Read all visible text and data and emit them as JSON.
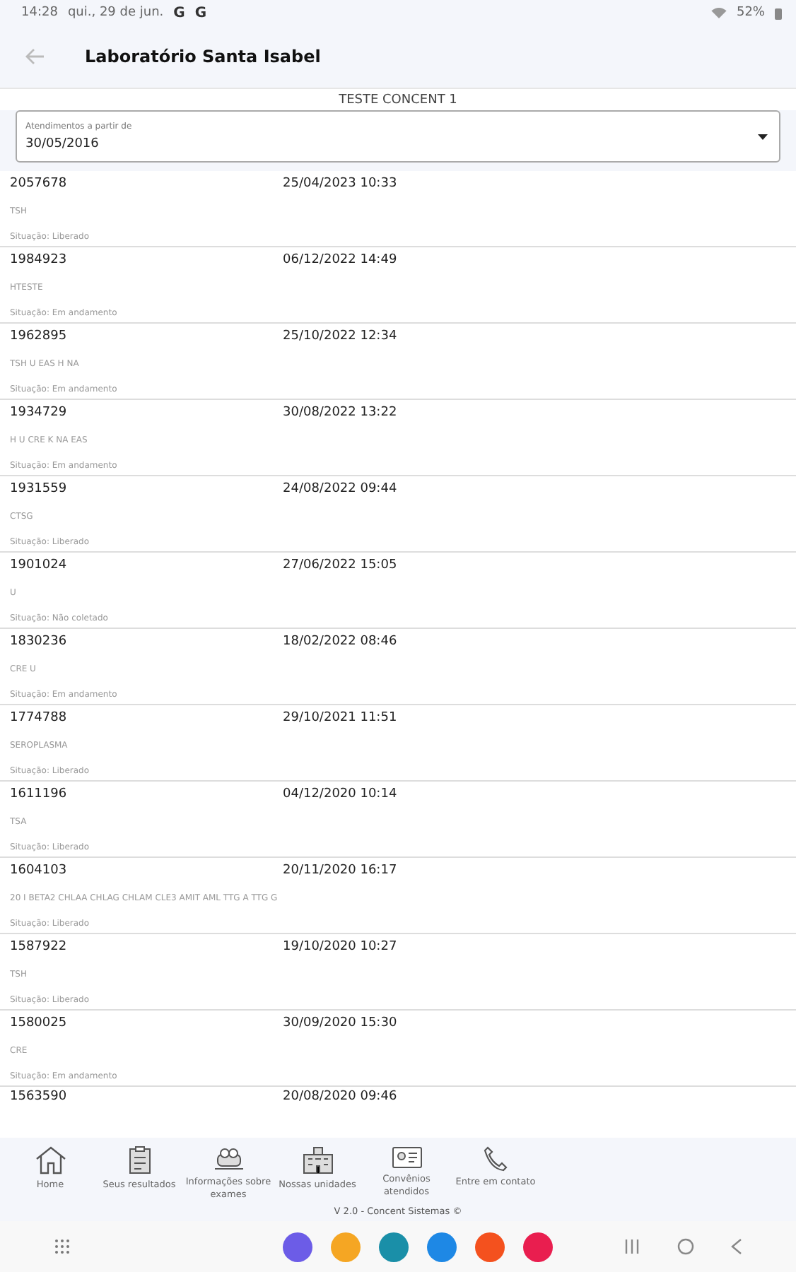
{
  "status_bar": {
    "time": "14:28",
    "date": "qui., 29 de jun.",
    "notification_icons": [
      "G",
      "G"
    ],
    "battery": "52%"
  },
  "app_bar": {
    "title": "Laboratório Santa Isabel"
  },
  "patient": "TESTE CONCENT 1",
  "date_filter": {
    "label": "Atendimentos a partir de",
    "value": "30/05/2016"
  },
  "records": [
    {
      "id": "2057678",
      "datetime": "25/04/2023 10:33",
      "exams": "TSH",
      "status": "Situação: Liberado"
    },
    {
      "id": "1984923",
      "datetime": "06/12/2022 14:49",
      "exams": "HTESTE",
      "status": "Situação: Em andamento"
    },
    {
      "id": "1962895",
      "datetime": "25/10/2022 12:34",
      "exams": "TSH U EAS H NA",
      "status": "Situação: Em andamento"
    },
    {
      "id": "1934729",
      "datetime": "30/08/2022 13:22",
      "exams": "H U CRE K NA EAS",
      "status": "Situação: Em andamento"
    },
    {
      "id": "1931559",
      "datetime": "24/08/2022 09:44",
      "exams": "CTSG",
      "status": "Situação: Liberado"
    },
    {
      "id": "1901024",
      "datetime": "27/06/2022 15:05",
      "exams": "U",
      "status": "Situação: Não coletado"
    },
    {
      "id": "1830236",
      "datetime": "18/02/2022 08:46",
      "exams": "CRE U",
      "status": "Situação: Em andamento"
    },
    {
      "id": "1774788",
      "datetime": "29/10/2021 11:51",
      "exams": "SEROPLASMA",
      "status": "Situação: Liberado"
    },
    {
      "id": "1611196",
      "datetime": "04/12/2020 10:14",
      "exams": "TSA",
      "status": "Situação: Liberado"
    },
    {
      "id": "1604103",
      "datetime": "20/11/2020 16:17",
      "exams": "20 I BETA2 CHLAA CHLAG CHLAM CLE3 AMIT AML TTG A TTG G",
      "status": "Situação: Liberado"
    },
    {
      "id": "1587922",
      "datetime": "19/10/2020 10:27",
      "exams": "TSH",
      "status": "Situação: Liberado"
    },
    {
      "id": "1580025",
      "datetime": "30/09/2020 15:30",
      "exams": "CRE",
      "status": "Situação: Em andamento"
    },
    {
      "id": "1563590",
      "datetime": "20/08/2020 09:46"
    }
  ],
  "bottom_nav": [
    {
      "kind": "home",
      "label": "Home"
    },
    {
      "kind": "results",
      "label": "Seus resultados"
    },
    {
      "kind": "info",
      "label": "Informações sobre exames"
    },
    {
      "kind": "units",
      "label": "Nossas unidades"
    },
    {
      "kind": "insurance",
      "label": "Convênios atendidos"
    },
    {
      "kind": "phone",
      "label": "Entre em contato"
    }
  ],
  "version": "V 2.0 - Concent Sistemas ©",
  "dock": [
    {
      "color": "#6c5ce7"
    },
    {
      "color": "#f5a623"
    },
    {
      "color": "#1a8fa8"
    },
    {
      "color": "#1e88e5"
    },
    {
      "color": "#f4511e"
    },
    {
      "color": "#e91e4f"
    }
  ]
}
